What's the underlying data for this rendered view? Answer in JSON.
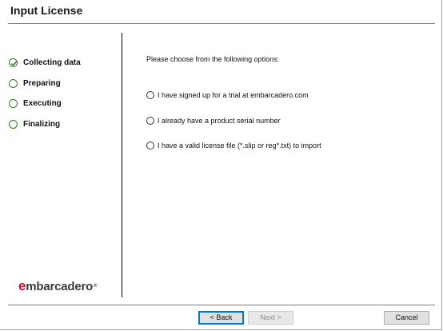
{
  "title": "Input License",
  "steps": [
    {
      "label": "Collecting data",
      "state": "done"
    },
    {
      "label": "Preparing",
      "state": "pending"
    },
    {
      "label": "Executing",
      "state": "pending"
    },
    {
      "label": "Finalizing",
      "state": "pending"
    }
  ],
  "main": {
    "prompt": "Please choose from the following options:",
    "options": [
      {
        "label": "I have signed up for a trial at embarcadero.com",
        "selected": false
      },
      {
        "label": "I already have a product serial number",
        "selected": false
      },
      {
        "label": "I have a valid license file (*.slip or reg*.txt) to import",
        "selected": false
      }
    ]
  },
  "logo": {
    "prefix": "e",
    "text": "mbarcadero",
    "tm": "®"
  },
  "buttons": {
    "back": "< Back",
    "next": "Next >",
    "cancel": "Cancel"
  },
  "colors": {
    "accent_green": "#2e7d1f",
    "brand_red": "#c8102e",
    "default_button_border": "#0078d7"
  }
}
